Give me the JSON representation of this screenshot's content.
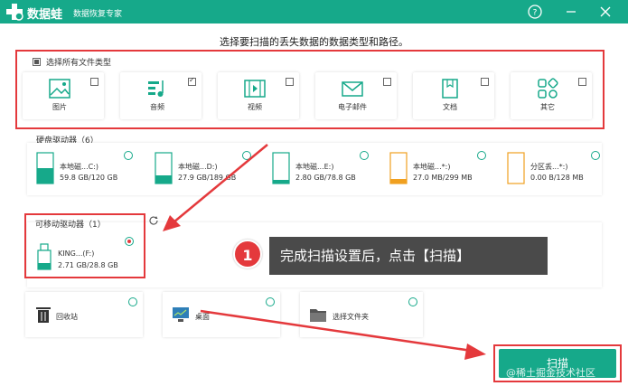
{
  "titlebar": {
    "app_name": "数据蛙",
    "subtitle": "数据恢复专家",
    "help_icon": "help-icon",
    "minimize_icon": "minimize-icon",
    "close_icon": "close-icon"
  },
  "instruction": "选择要扫描的丢失数据的数据类型和路径。",
  "file_types": {
    "select_all_label": "选择所有文件类型",
    "items": [
      {
        "label": "图片",
        "icon": "image-icon",
        "checked": false
      },
      {
        "label": "音频",
        "icon": "audio-icon",
        "checked": true
      },
      {
        "label": "视频",
        "icon": "video-icon",
        "checked": false
      },
      {
        "label": "电子邮件",
        "icon": "email-icon",
        "checked": false
      },
      {
        "label": "文档",
        "icon": "document-icon",
        "checked": false
      },
      {
        "label": "其它",
        "icon": "other-icon",
        "checked": false
      }
    ]
  },
  "hard_drives": {
    "title": "硬盘驱动器（6）",
    "items": [
      {
        "name": "本地磁...C:)",
        "size": "59.8 GB/120 GB"
      },
      {
        "name": "本地磁...D:)",
        "size": "27.9 GB/189 GB"
      },
      {
        "name": "本地磁...E:)",
        "size": "2.80 GB/78.8 GB"
      },
      {
        "name": "本地磁...*:)",
        "size": "27.0 MB/299 MB"
      },
      {
        "name": "分区丢...*:)",
        "size": "0.00  B/128 MB"
      }
    ]
  },
  "removable": {
    "title": "可移动驱动器（1）",
    "item": {
      "name": "KING...(F:)",
      "size": "2.71 GB/28.8 GB"
    }
  },
  "quick_locations": [
    {
      "label": "回收站",
      "icon": "recycle-bin-icon"
    },
    {
      "label": "桌面",
      "icon": "desktop-icon"
    },
    {
      "label": "选择文件夹",
      "icon": "folder-icon"
    }
  ],
  "callout": {
    "step": "1",
    "text": "完成扫描设置后，点击【扫描】"
  },
  "scan_button": "扫描",
  "watermark": "@稀土掘金技术社区",
  "colors": {
    "brand": "#16a98a",
    "highlight": "#e4393c"
  }
}
